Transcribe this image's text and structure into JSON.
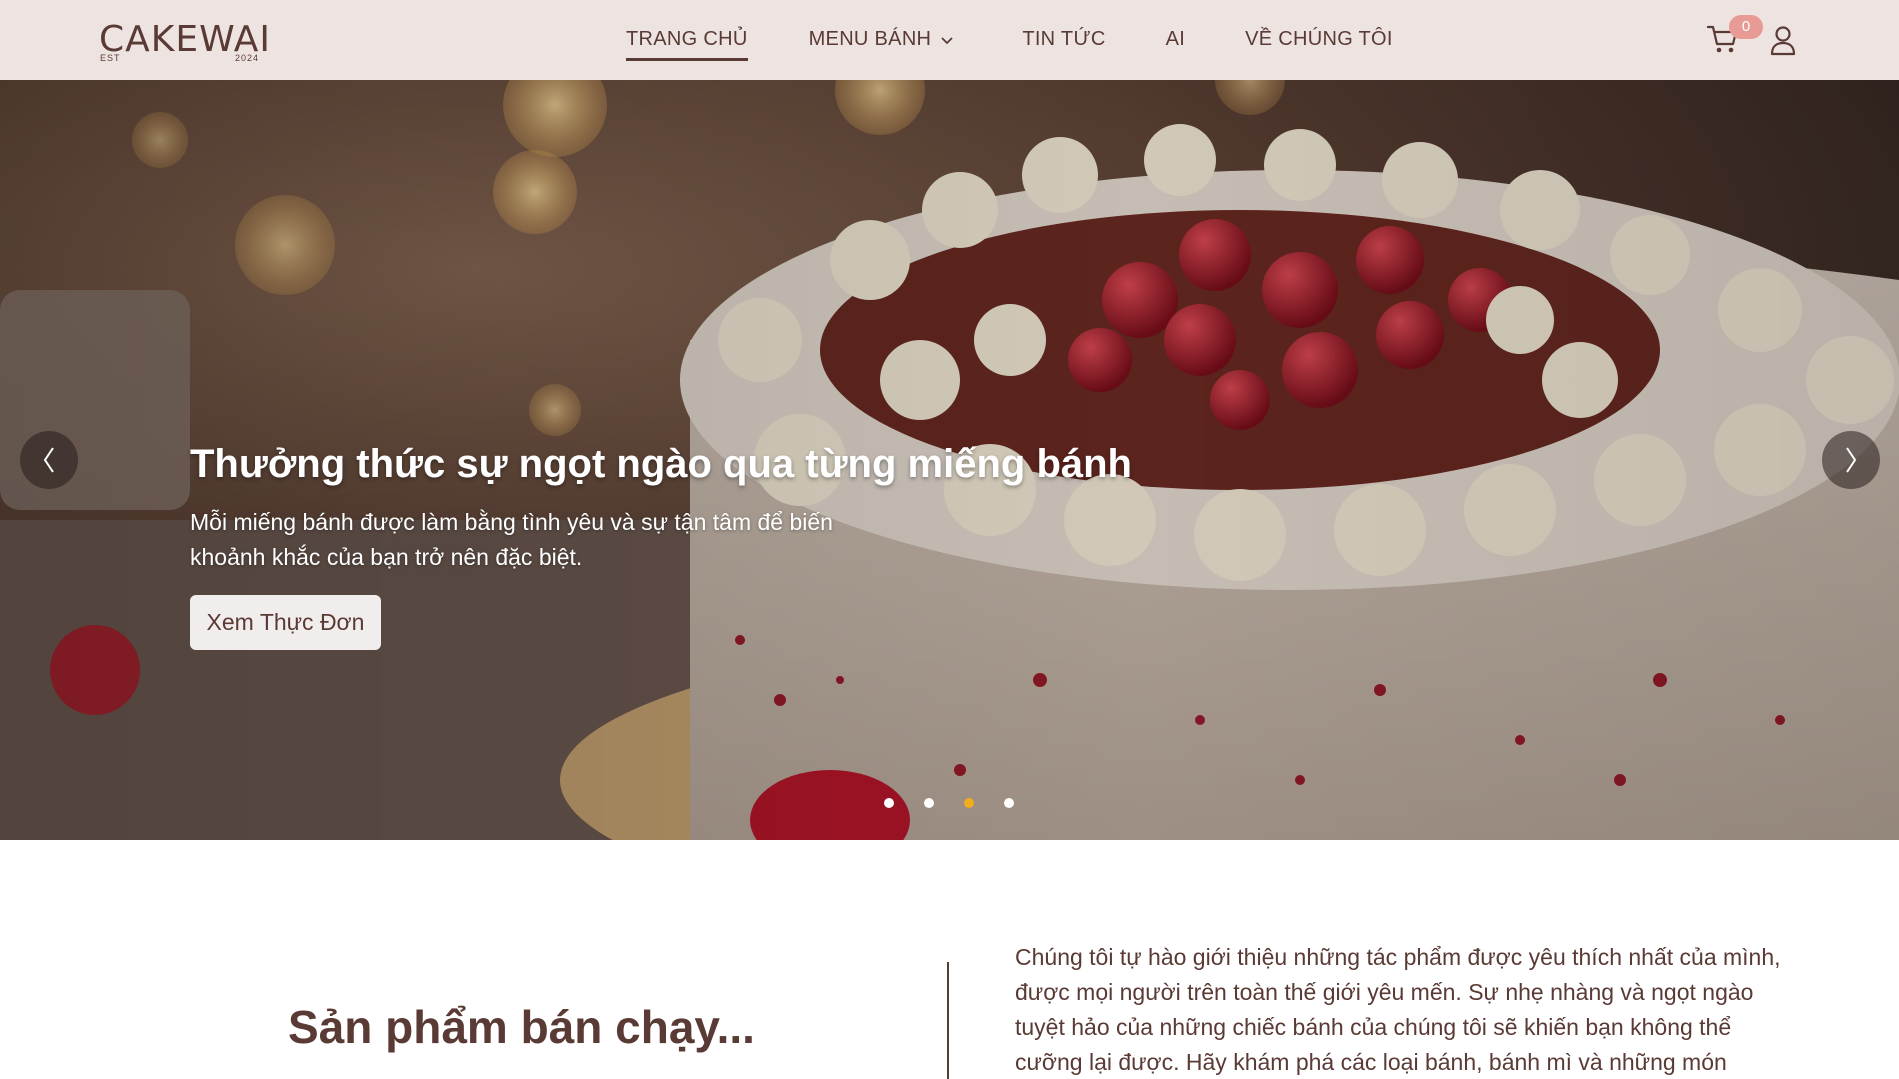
{
  "brand": {
    "logo_text": "CAKEWAI",
    "est": "EST",
    "year": "2024"
  },
  "nav": {
    "items": [
      {
        "label": "TRANG CHỦ",
        "active": true
      },
      {
        "label": "MENU BÁNH",
        "active": false
      },
      {
        "label": "TIN TỨC",
        "active": false
      },
      {
        "label": "AI",
        "active": false
      },
      {
        "label": "VỀ CHÚNG TÔI",
        "active": false
      }
    ]
  },
  "cart": {
    "count": "0",
    "icon": "cart-icon"
  },
  "user": {
    "icon": "user-icon"
  },
  "hero": {
    "title": "Thưởng thức sự ngọt ngào qua từng miếng bánh",
    "description": "Mỗi miếng bánh được làm bằng tình yêu và sự tận tâm để biến khoảnh khắc của bạn trở nên đặc biệt.",
    "button_label": "Xem Thực Đơn",
    "prev_label": "〈",
    "next_label": "〉",
    "slide_count": 4,
    "active_slide": 3,
    "active_dot_color": "#f0ad1e"
  },
  "bestsellers": {
    "title": "Sản phẩm bán chạy...",
    "intro": "Chúng tôi tự hào giới thiệu những tác phẩm được yêu thích nhất của mình, được mọi người trên toàn thế giới yêu mến. Sự nhẹ nhàng và ngọt ngào tuyệt hảo của những chiếc bánh của chúng tôi sẽ khiến bạn không thể cưỡng lại được. Hãy khám phá các loại bánh, bánh mì và những món"
  },
  "colors": {
    "header_bg": "#ede4e2",
    "brand_text": "#5a3a35",
    "badge": "#e89a94"
  }
}
